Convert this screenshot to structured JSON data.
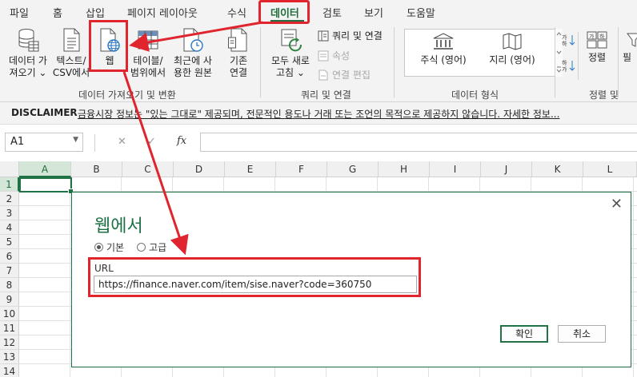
{
  "tabs": [
    {
      "label": "파일"
    },
    {
      "label": "홈"
    },
    {
      "label": "삽입"
    },
    {
      "label": "페이지 레이아웃"
    },
    {
      "label": "수식"
    },
    {
      "label": "데이터"
    },
    {
      "label": "검토"
    },
    {
      "label": "보기"
    },
    {
      "label": "도움말"
    }
  ],
  "active_tab": "데이터",
  "ribbon": {
    "get_transform": {
      "btn_get_data": [
        "데이터 가",
        "져오기 ⌄"
      ],
      "btn_text_csv": [
        "텍스트/",
        "CSV에서"
      ],
      "btn_web": [
        "웹"
      ],
      "btn_table_range": [
        "테이블/",
        "범위에서"
      ],
      "btn_recent": [
        "최근에 사",
        "용한 원본"
      ],
      "btn_existing": [
        "기존",
        "연결"
      ],
      "group_label": "데이터 가져오기 및 변환"
    },
    "queries": {
      "btn_refresh_all": [
        "모두 새로",
        "고침 ⌄"
      ],
      "queries_connections": "쿼리 및 연결",
      "properties": "속성",
      "edit_links": "연결 편집",
      "group_label": "쿼리 및 연결"
    },
    "data_types": {
      "stocks": "주식 (영어)",
      "geography": "지리 (영어)",
      "group_label": "데이터 형식"
    },
    "sort_filter": {
      "sort": "정렬",
      "filter_partial": "필",
      "group_label": "정렬 및"
    }
  },
  "disclaimer": {
    "title": "DISCLAIMER",
    "text": "금융시장 정보는 \"있는 그대로\" 제공되며, 전문적인 용도나 거래 또는 조언의 목적으로 제공하지 않습니다. 자세한 정보..."
  },
  "formula_bar": {
    "name_box": "A1",
    "cancel": "✕",
    "enter": "✓",
    "fx": "fx"
  },
  "grid": {
    "columns": [
      "A",
      "B",
      "C",
      "D",
      "E",
      "F",
      "G",
      "H",
      "I",
      "J",
      "K",
      "L"
    ],
    "rows": [
      "1",
      "2",
      "3",
      "4",
      "5",
      "6",
      "7",
      "8",
      "9",
      "10",
      "11",
      "12",
      "13",
      "14"
    ]
  },
  "dialog": {
    "title": "웹에서",
    "close": "✕",
    "radio_basic": "기본",
    "radio_advanced": "고급",
    "url_label": "URL",
    "url_value": "https://finance.naver.com/item/sise.naver?code=360750",
    "ok": "확인",
    "cancel": "취소"
  },
  "colors": {
    "accent_green": "#217346",
    "highlight_red": "#e0252f"
  }
}
